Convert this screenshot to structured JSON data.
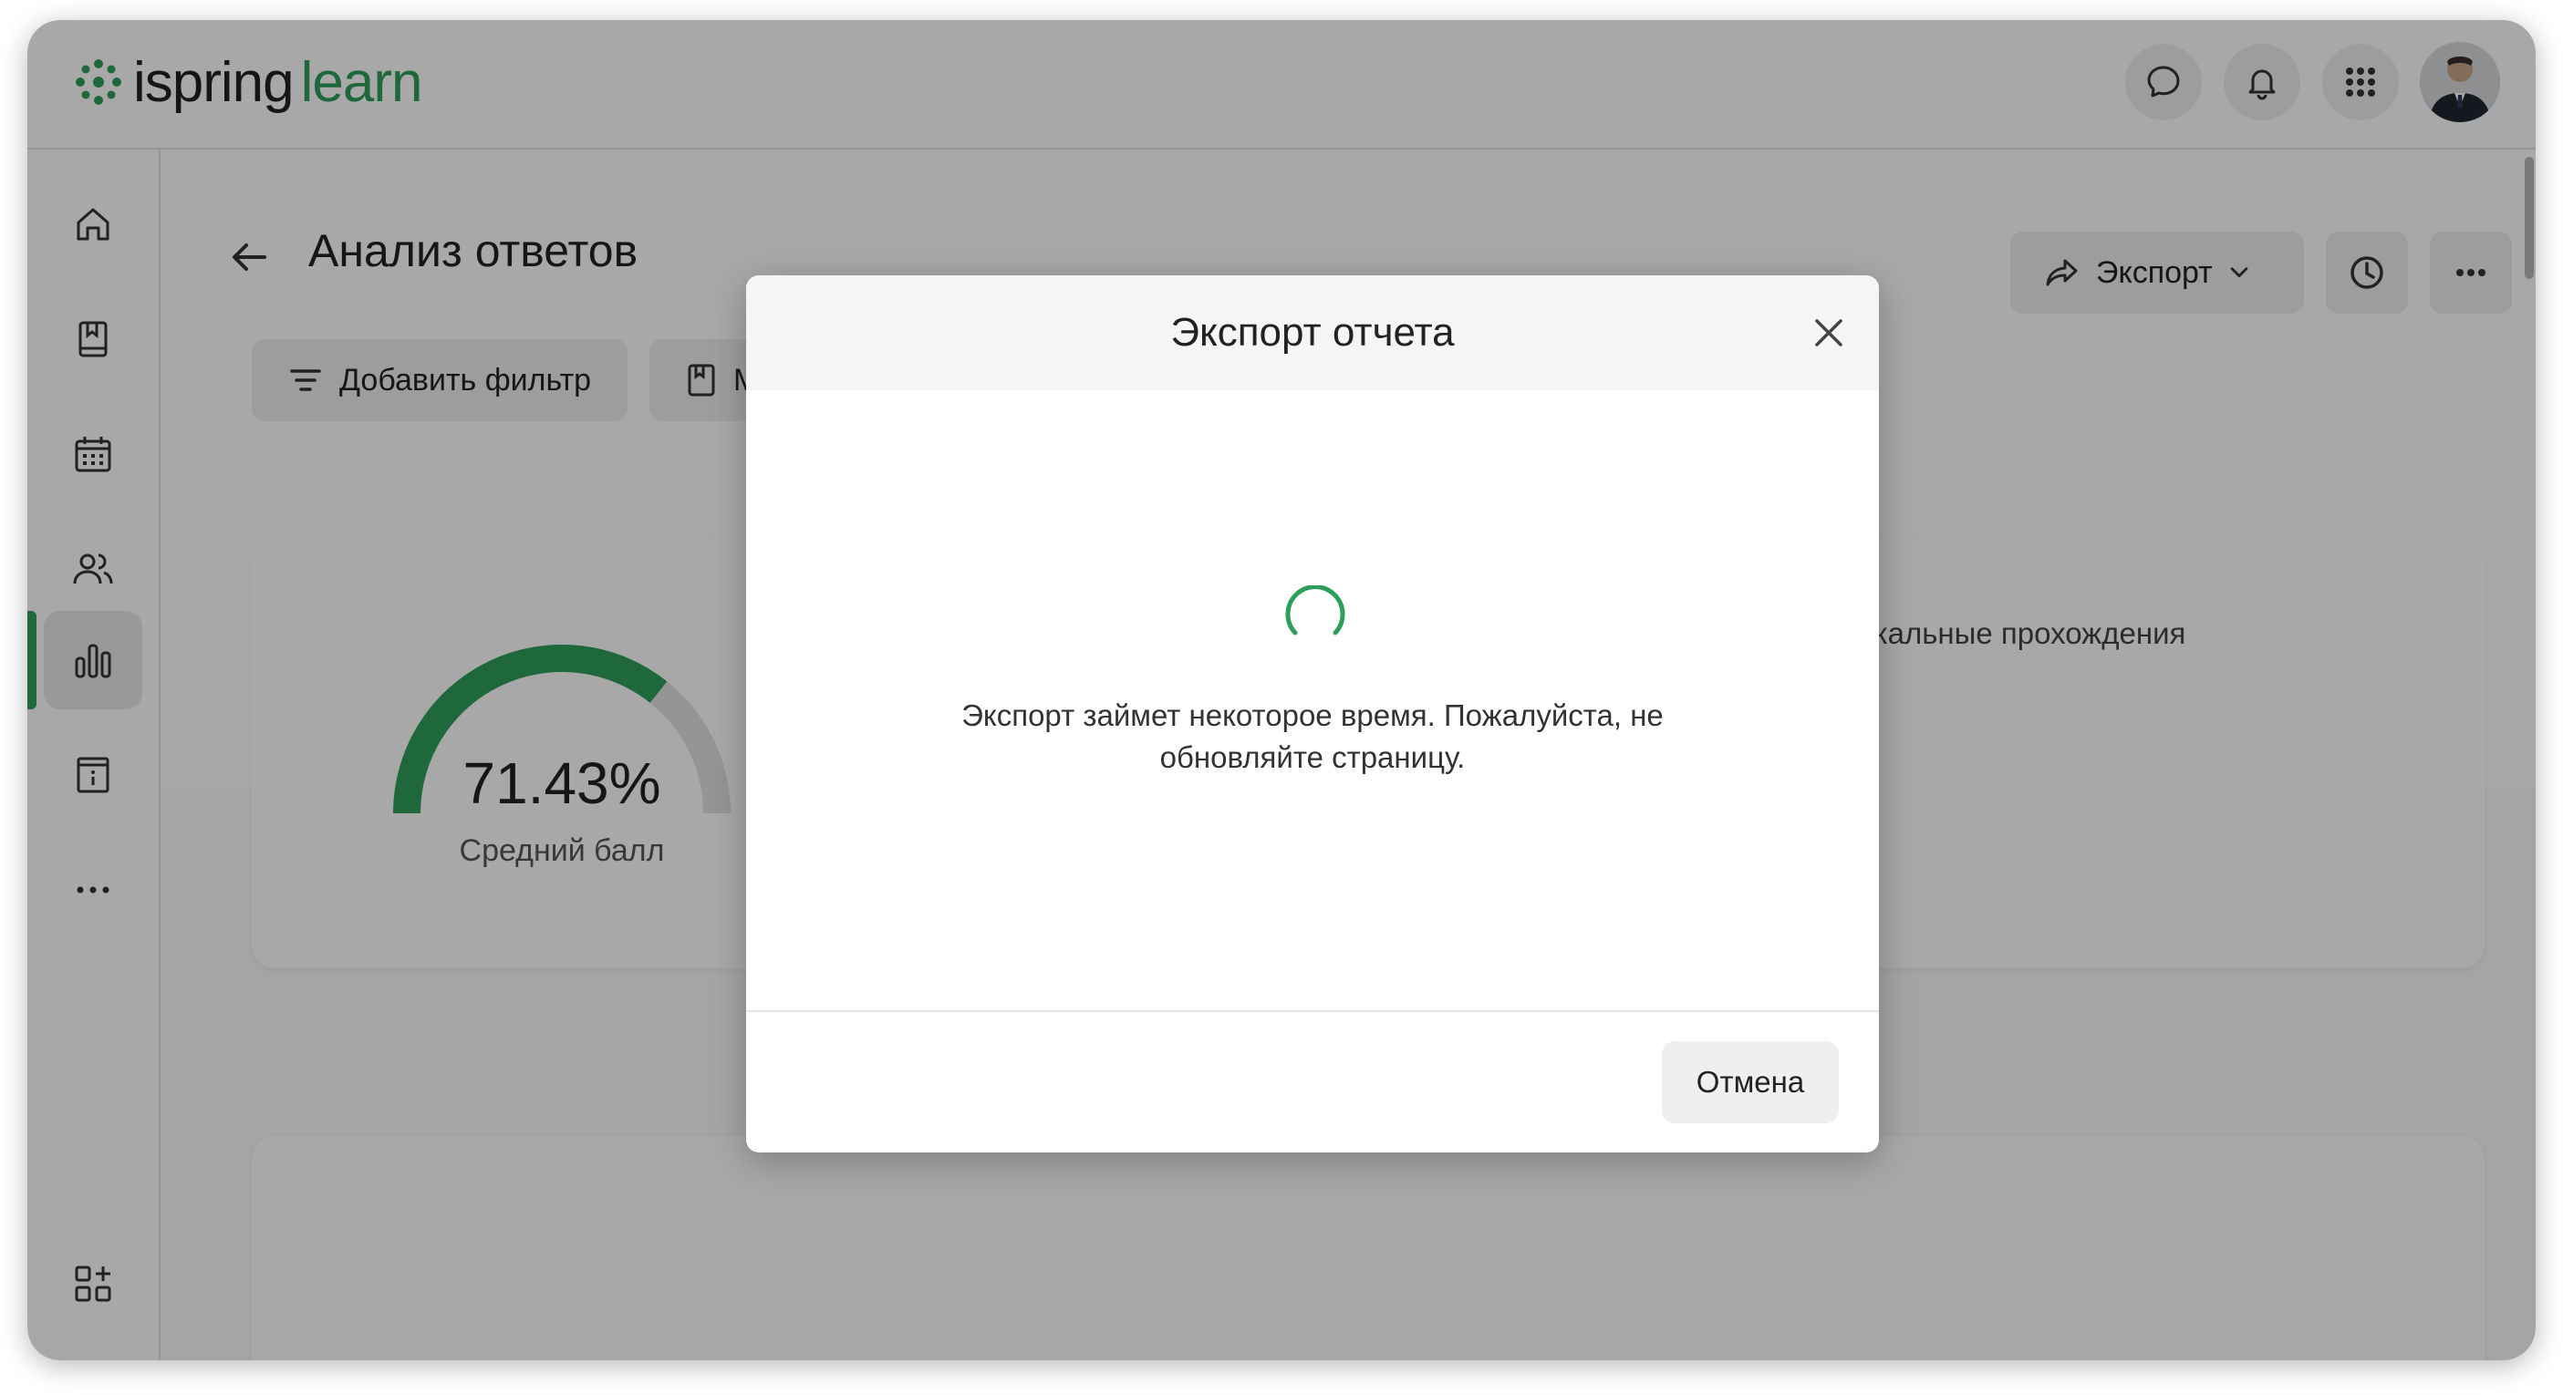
{
  "app": {
    "logo_part1": "ispring",
    "logo_part2": "learn",
    "brand_color": "#2e9e5b"
  },
  "topbar": {
    "icons": [
      "chat-icon",
      "bell-icon",
      "apps-grid-icon",
      "avatar"
    ]
  },
  "sidebar": {
    "items": [
      "home-icon",
      "book-icon",
      "calendar-icon",
      "users-icon",
      "chart-icon",
      "info-icon",
      "more-icon",
      "add-widget-icon"
    ],
    "active": "chart-icon"
  },
  "page": {
    "title": "Анализ ответов",
    "add_filter_label": "Добавить фильтр",
    "second_filter_label": "М",
    "export_label": "Экспорт",
    "card_right_text": "икальные прохождения"
  },
  "gauge": {
    "value": 71.43,
    "value_text": "71.43%",
    "label": "Средний балл"
  },
  "modal": {
    "title": "Экспорт отчета",
    "message_line1": "Экспорт займет некоторое время. Пожалуйста, не",
    "message_line2": "обновляйте страницу.",
    "cancel_label": "Отмена"
  }
}
